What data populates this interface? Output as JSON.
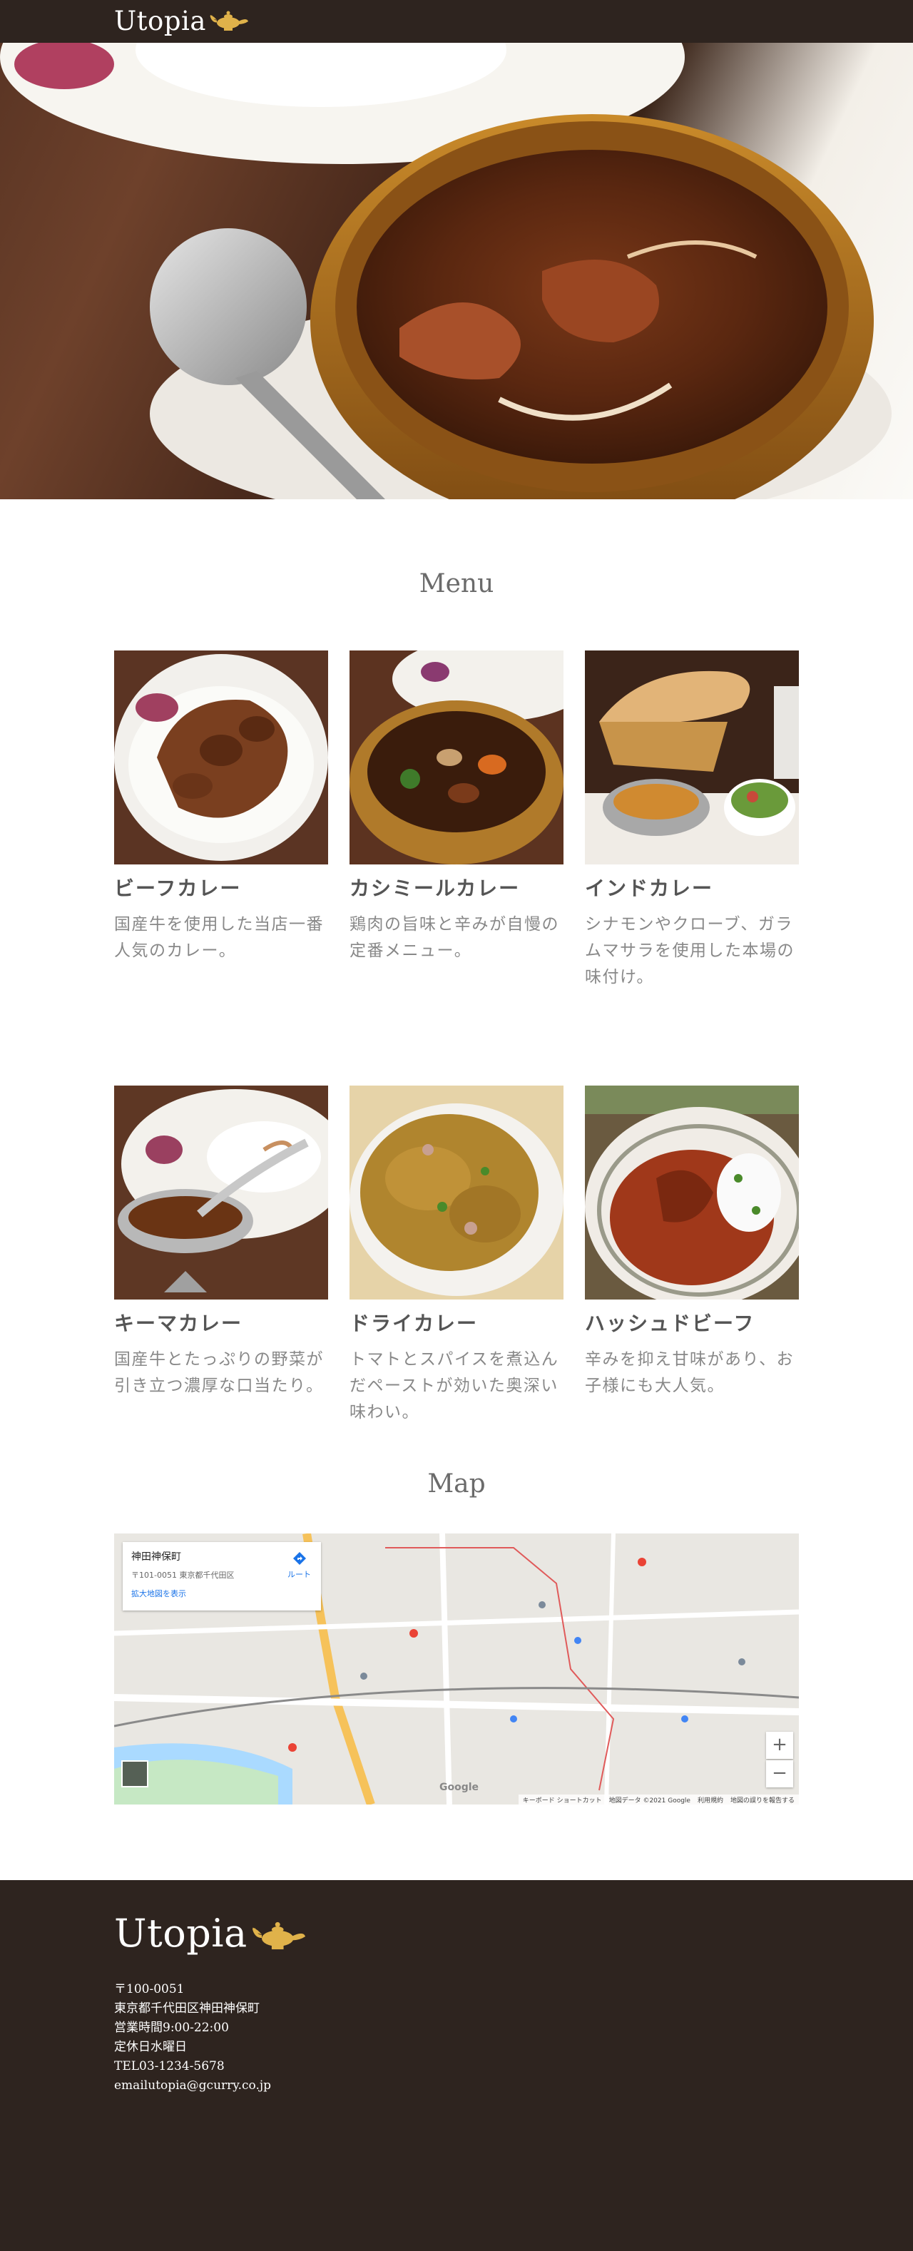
{
  "header": {
    "logo_text": "Utopia"
  },
  "menu": {
    "title": "Menu",
    "items": [
      {
        "name": "ビーフカレー",
        "description": "国産牛を使用した当店一番人気のカレー。",
        "photo": "beef-curry-photo"
      },
      {
        "name": "カシミールカレー",
        "description": "鶏肉の旨味と辛みが自慢の定番メニュー。",
        "photo": "kashmir-curry-photo"
      },
      {
        "name": "インドカレー",
        "description": "シナモンやクローブ、ガラムマサラを使用した本場の味付け。",
        "photo": "indian-curry-photo"
      },
      {
        "name": "キーマカレー",
        "description": "国産牛とたっぷりの野菜が引き立つ濃厚な口当たり。",
        "photo": "keema-curry-photo"
      },
      {
        "name": "ドライカレー",
        "description": "トマトとスパイスを煮込んだペーストが効いた奥深い味わい。",
        "photo": "dry-curry-photo"
      },
      {
        "name": "ハッシュドビーフ",
        "description": "辛みを抑え甘味があり、お子様にも大人気。",
        "photo": "hashed-beef-photo"
      }
    ]
  },
  "map": {
    "title": "Map",
    "place_name": "神田神保町",
    "place_address": "〒101-0051 東京都千代田区",
    "larger_map_link": "拡大地図を表示",
    "route_label": "ルート",
    "zoom_in": "+",
    "zoom_out": "−",
    "google_label": "Google",
    "attribution": [
      "キーボード ショートカット",
      "地図データ ©2021 Google",
      "利用規約",
      "地図の誤りを報告する"
    ]
  },
  "footer": {
    "logo_text": "Utopia",
    "postal": "〒100-0051",
    "address": "東京都千代田区神田神保町",
    "hours": "営業時間9:00-22:00",
    "closed": "定休日水曜日",
    "tel": "TEL03-1234-5678",
    "email": "emailutopia@gcurry.co.jp"
  },
  "colors": {
    "header_bg": "#2e241f",
    "lamp": "#e0b24a"
  }
}
